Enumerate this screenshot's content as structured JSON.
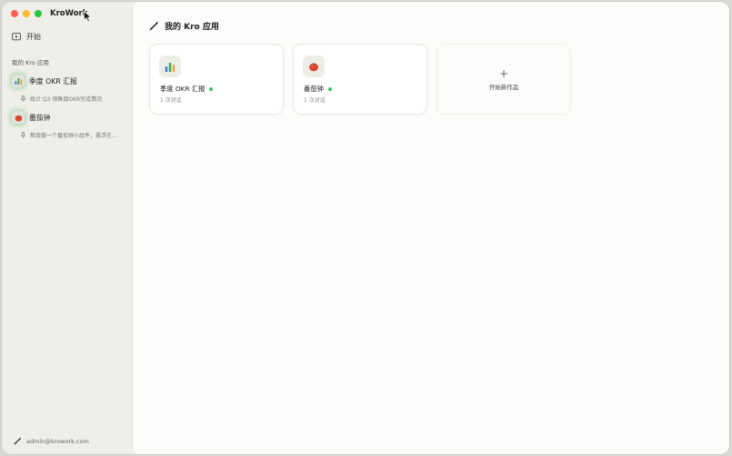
{
  "app": {
    "name": "KroWork",
    "window_controls": [
      "close",
      "minimize",
      "zoom"
    ],
    "colors": {
      "close": "#fe5f57",
      "minimize": "#febc2e",
      "zoom": "#28c840",
      "status_dot": "#34c759"
    }
  },
  "sidebar": {
    "start_label": "开始",
    "section_label": "我的 Kro 应用",
    "apps": [
      {
        "label": "季度 OKR 汇报",
        "icon": "bar-chart-icon",
        "sub": "统计 Q3 销售部OKR完成情况"
      },
      {
        "label": "番茄钟",
        "icon": "tomato-icon",
        "sub": "帮我做一个番茄钟小组件，悬浮在..."
      }
    ],
    "footer_email": "admin@krowork.com"
  },
  "main": {
    "header_title": "我的 Kro 应用",
    "cards": [
      {
        "title": "季度 OKR 汇报",
        "icon": "bar-chart-icon",
        "sub": "1 次对话"
      },
      {
        "title": "番茄钟",
        "icon": "tomato-icon",
        "sub": "1 次对话"
      }
    ],
    "new_card": {
      "plus": "+",
      "label": "开始新作品"
    }
  }
}
